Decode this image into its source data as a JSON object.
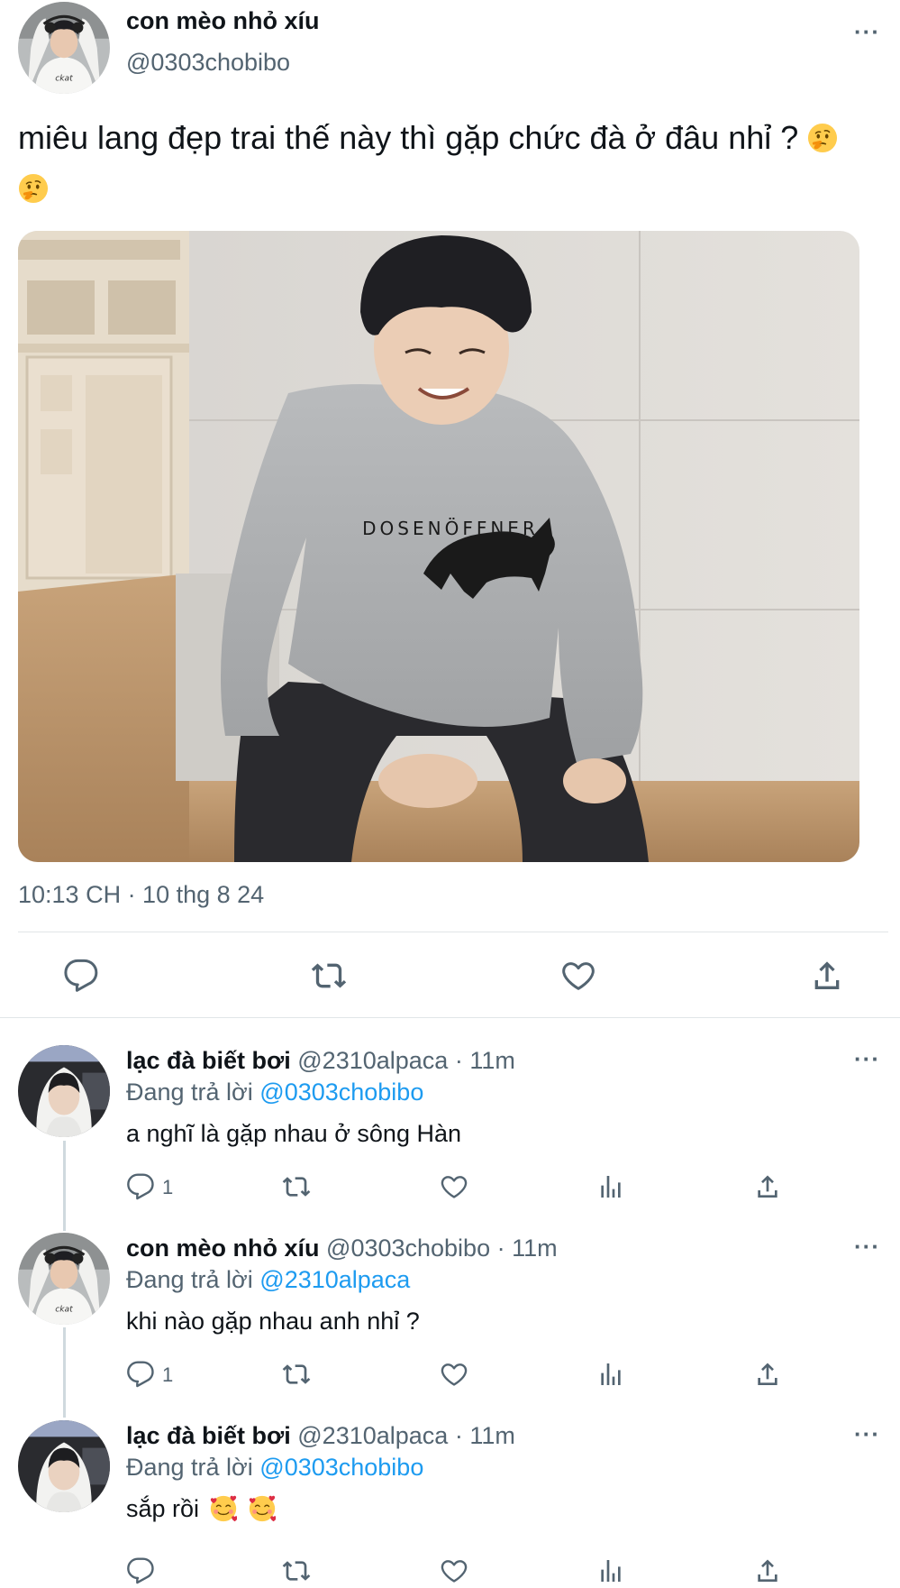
{
  "main_tweet": {
    "author_name": "con mèo nhỏ xíu",
    "author_handle": "@0303chobibo",
    "text": "miêu lang đẹp trai thế này thì gặp chức đà ở đâu nhỉ ?",
    "emoji": "thinking-face",
    "shirt_print": "DOSENÖFFNER",
    "timestamp": "10:13 CH · 10 thg 8 24",
    "more_label": "···"
  },
  "replies": [
    {
      "author_name": "lạc đà biết bơi",
      "author_handle": "@2310alpaca",
      "time": "· 11m",
      "replying_prefix": "Đang trả lời",
      "replying_to": "@0303chobibo",
      "text": "a nghĩ là gặp nhau ở sông Hàn",
      "reply_count": "1",
      "more_label": "···"
    },
    {
      "author_name": "con mèo nhỏ xíu",
      "author_handle": "@0303chobibo",
      "time": "· 11m",
      "replying_prefix": "Đang trả lời",
      "replying_to": "@2310alpaca",
      "text": "khi nào gặp nhau anh nhỉ ?",
      "reply_count": "1",
      "more_label": "···"
    },
    {
      "author_name": "lạc đà biết bơi",
      "author_handle": "@2310alpaca",
      "time": "· 11m",
      "replying_prefix": "Đang trả lời",
      "replying_to": "@0303chobibo",
      "text": "sắp rồi",
      "text_emoji": "smiling-face-with-hearts",
      "reply_count": "",
      "more_label": "···"
    }
  ],
  "colors": {
    "text_primary": "#0f1419",
    "text_secondary": "#536471",
    "link": "#1d9bf0",
    "divider": "#e1e5e8"
  }
}
